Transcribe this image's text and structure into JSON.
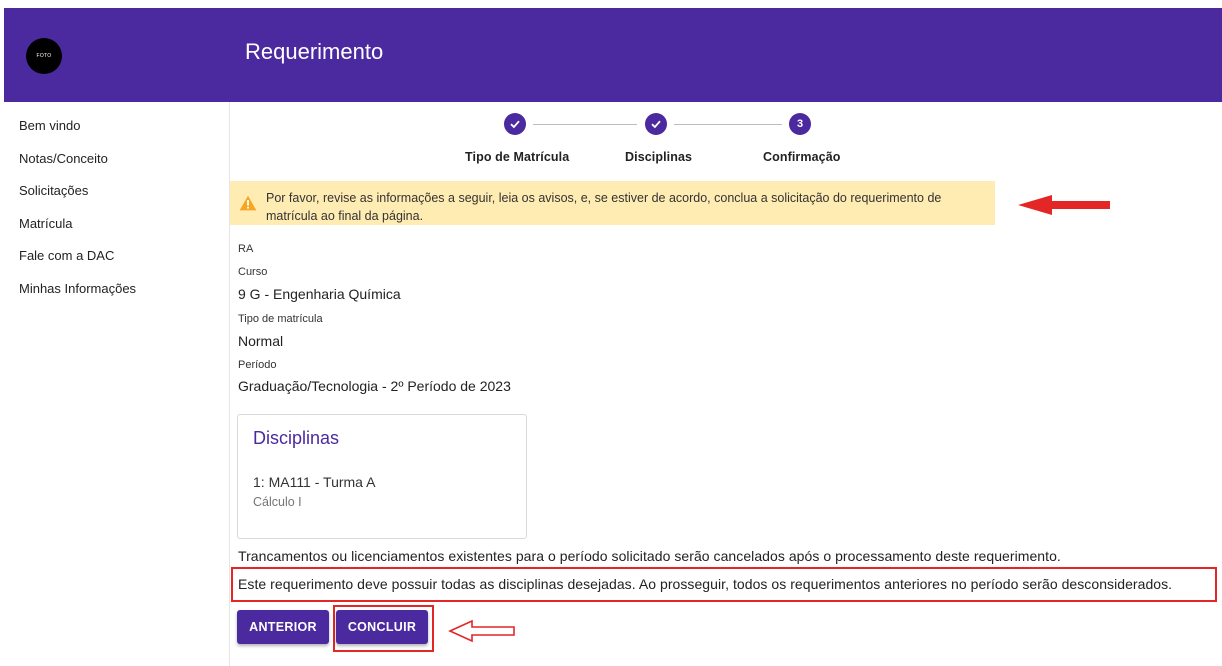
{
  "sidebar": {
    "logo_text": "FOTO",
    "items": [
      {
        "label": "Bem vindo"
      },
      {
        "label": "Notas/Conceito"
      },
      {
        "label": "Solicitações"
      },
      {
        "label": "Matrícula"
      },
      {
        "label": "Fale com a DAC"
      },
      {
        "label": "Minhas Informações"
      }
    ]
  },
  "header": {
    "title": "Requerimento"
  },
  "stepper": {
    "steps": [
      {
        "label": "Tipo de Matrícula",
        "state": "done",
        "icon": "check-icon"
      },
      {
        "label": "Disciplinas",
        "state": "done",
        "icon": "check-icon"
      },
      {
        "label": "Confirmação",
        "state": "active",
        "number": "3"
      }
    ]
  },
  "alert": {
    "icon": "warning-icon",
    "text": "Por favor, revise as informações a seguir, leia os avisos, e, se estiver de acordo, conclua a solicitação do requerimento de matrícula ao final da página."
  },
  "info": {
    "ra_label": "RA",
    "ra_value": "",
    "curso_label": "Curso",
    "curso_value": "9 G - Engenharia Química",
    "tipo_label": "Tipo de matrícula",
    "tipo_value": "Normal",
    "periodo_label": "Período",
    "periodo_value": "Graduação/Tecnologia - 2º Período de 2023"
  },
  "disciplinas_card": {
    "title": "Disciplinas",
    "items": [
      {
        "code": "1: MA111 - Turma A",
        "name": "Cálculo I"
      }
    ]
  },
  "notices": {
    "trancamentos": "Trancamentos ou licenciamentos existentes para o período solicitado serão cancelados após o processamento deste requerimento.",
    "requerimento": "Este requerimento deve possuir todas as disciplinas desejadas. Ao prosseguir, todos os requerimentos anteriores no período serão desconsiderados."
  },
  "buttons": {
    "anterior": "ANTERIOR",
    "concluir": "CONCLUIR"
  },
  "colors": {
    "primary": "#4b2aa0",
    "alert_bg": "#ffecb3",
    "warning": "#f5a623",
    "annotation_red": "#e32626"
  }
}
